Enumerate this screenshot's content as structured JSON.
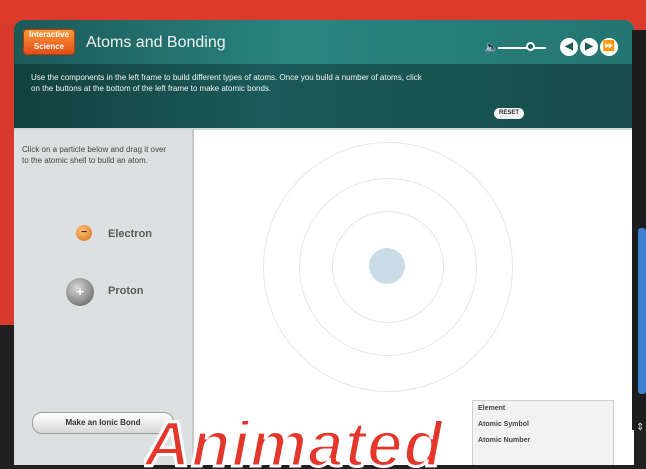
{
  "app": {
    "title": "Atoms and Bonding",
    "logo_text": "Interactive Science",
    "instructions": "Use the components in the left frame to build different types of atoms. Once you build a number of atoms, click on the buttons at the bottom of the left frame to make atomic bonds.",
    "reset_label": "RESET",
    "controls": {
      "back": "◀",
      "play": "▶",
      "forward": "⏩"
    }
  },
  "left_panel": {
    "hint": "Click on a particle below and drag it over to the atomic shell to build an atom.",
    "particles": [
      {
        "label": "Electron",
        "symbol": "−"
      },
      {
        "label": "Proton",
        "symbol": "+"
      }
    ],
    "ionic_button": "Make an Ionic Bond"
  },
  "info": {
    "rows": [
      "Element",
      "Atomic Symbol",
      "Atomic Number"
    ]
  },
  "banner": {
    "text": "Animated"
  },
  "colors": {
    "header_teal": "#1b5956",
    "accent_red": "#d93a2e",
    "nucleus": "#c9dbe4"
  }
}
